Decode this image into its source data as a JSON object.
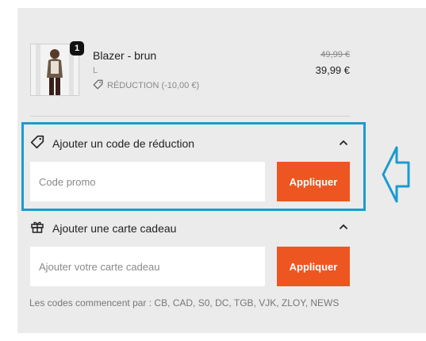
{
  "product": {
    "quantity": "1",
    "name": "Blazer - brun",
    "size": "L",
    "discount_label": "RÉDUCTION (-10,00 €)",
    "original_price": "49,99 €",
    "price": "39,99 €"
  },
  "promo": {
    "title": "Ajouter un code de réduction",
    "placeholder": "Code promo",
    "button": "Appliquer"
  },
  "gift": {
    "title": "Ajouter une carte cadeau",
    "placeholder": "Ajouter votre carte cadeau",
    "button": "Appliquer"
  },
  "note": "Les codes commencent par : CB, CAD, S0, DC, TGB, VJK, ZLOY, NEWS",
  "colors": {
    "accent": "#ee5621",
    "highlight": "#1a9bd1",
    "panel": "#ebebeb"
  },
  "icons": [
    "tag-icon",
    "gift-icon",
    "chevron-up-icon",
    "arrow-left-icon"
  ]
}
